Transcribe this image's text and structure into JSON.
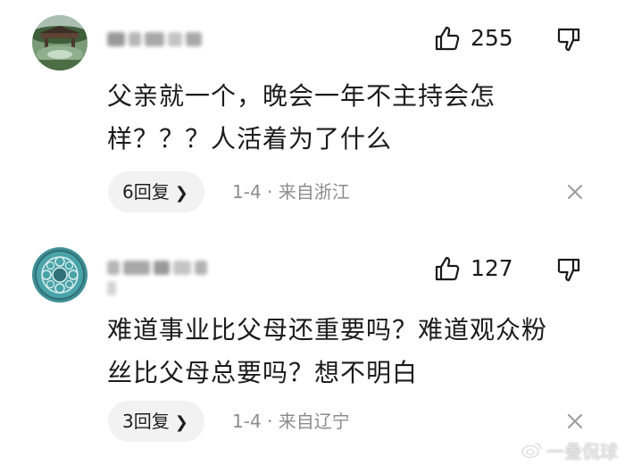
{
  "comments": [
    {
      "avatar": "landscape-avatar",
      "likes": "255",
      "text_line1": "父亲就一个，晚会一年不主持会怎",
      "text_line2": "样？？？人活着为了什么",
      "reply_label": "6回复",
      "meta": "1-4 · 来自浙江"
    },
    {
      "avatar": "pattern-avatar",
      "likes": "127",
      "text_line1": "难道事业比父母还重要吗？难道观众粉",
      "text_line2": "丝比父母总要吗？想不明白",
      "reply_label": "3回复",
      "meta": "1-4 · 来自辽宁"
    }
  ],
  "icons": {
    "like": "thumbs-up-icon",
    "dislike": "thumbs-down-icon",
    "close": "close-icon",
    "chevron": "chevron-right-icon"
  },
  "watermark": {
    "text": "一叠侃球"
  },
  "colors": {
    "meta_text": "#8c8c8c",
    "reply_bg": "#f2f2f2"
  }
}
